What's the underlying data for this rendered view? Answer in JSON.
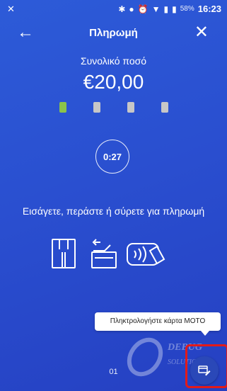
{
  "status_bar": {
    "left_icon": "x-icon",
    "battery_percent": "58%",
    "time": "16:23"
  },
  "header": {
    "title": "Πληρωμή",
    "back_icon": "arrow-left-icon",
    "close_icon": "close-icon"
  },
  "payment": {
    "total_label": "Συνολικό ποσό",
    "amount": "€20,00",
    "progress_steps": 4,
    "active_step": 1,
    "timer": "0:27",
    "instruction": "Εισάγετε, περάστε ή σύρετε για πληρωμή"
  },
  "tooltip": {
    "text": "Πληκτρολογήστε κάρτα MOTO"
  },
  "footer": {
    "page_number": "01"
  },
  "colors": {
    "background": "#2a4fd0",
    "active_dot": "#8bc34a",
    "inactive_dot": "#c7c7c7",
    "highlight": "#e21a1a"
  }
}
